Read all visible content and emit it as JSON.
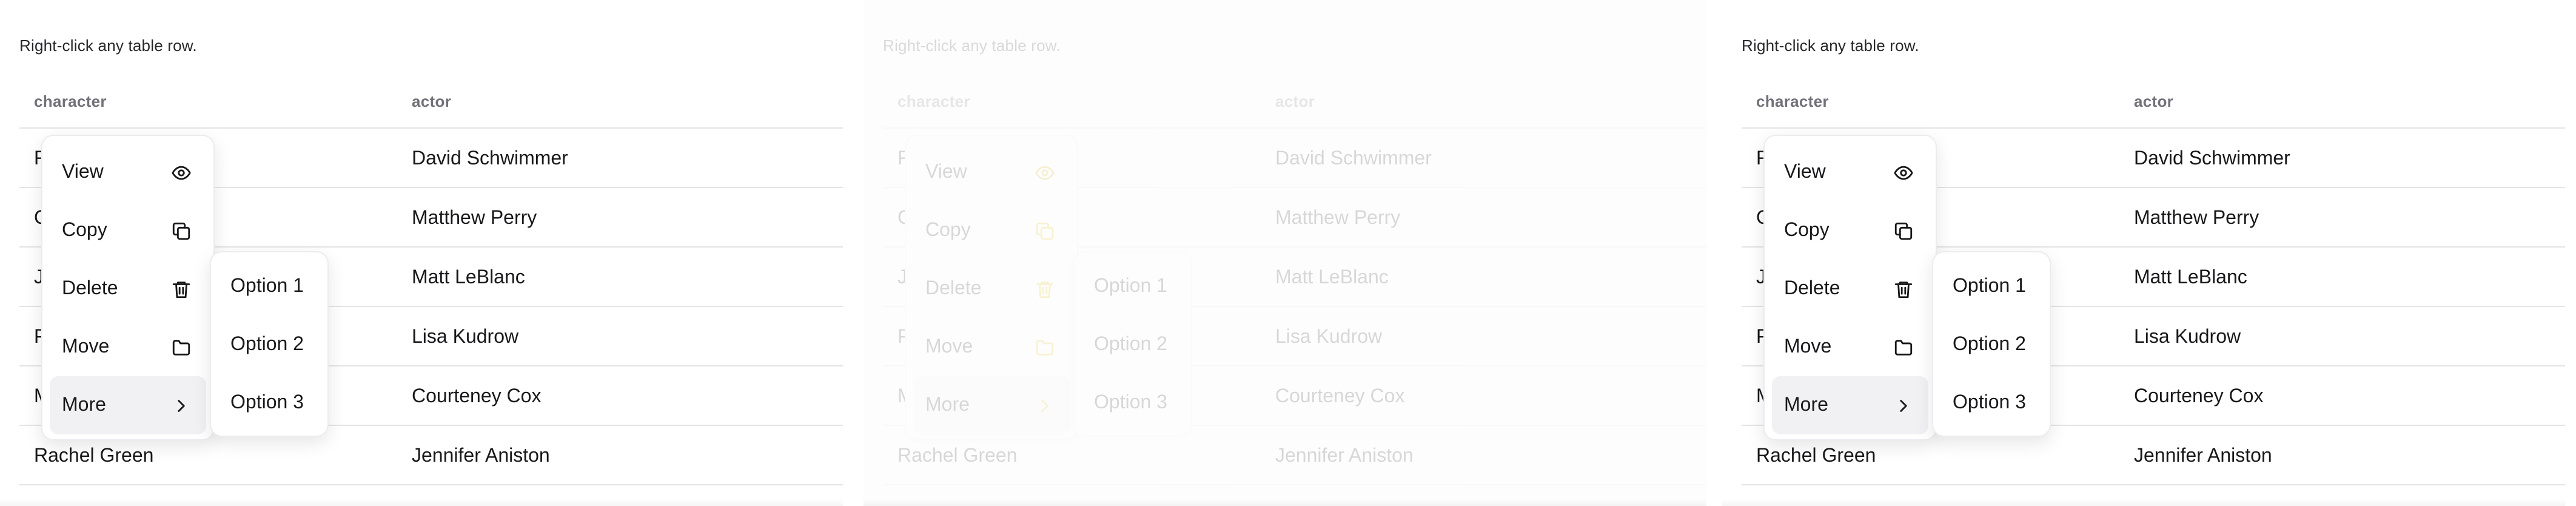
{
  "hint": "Right-click any table row.",
  "table": {
    "headers": [
      "character",
      "actor"
    ],
    "rows": [
      [
        "Ross Geller",
        "David Schwimmer"
      ],
      [
        "Chandler Bing",
        "Matthew Perry"
      ],
      [
        "Joey Tribbiani",
        "Matt LeBlanc"
      ],
      [
        "Phoebe Buffay",
        "Lisa Kudrow"
      ],
      [
        "Monica Geller",
        "Courteney Cox"
      ],
      [
        "Rachel Green",
        "Jennifer Aniston"
      ]
    ]
  },
  "context_menu": {
    "items": [
      {
        "label": "View",
        "icon": "eye-icon"
      },
      {
        "label": "Copy",
        "icon": "copy-icon"
      },
      {
        "label": "Delete",
        "icon": "trash-icon"
      },
      {
        "label": "Move",
        "icon": "folder-icon"
      },
      {
        "label": "More",
        "icon": "chevron-right-icon"
      }
    ],
    "active_item": "More"
  },
  "submenu": {
    "items": [
      "Option 1",
      "Option 2",
      "Option 3"
    ]
  },
  "colors": {
    "text": "#18181b",
    "muted_header": "#71717a",
    "border": "#e4e4e7",
    "active_item_bg": "#f1f1f3",
    "faded_icon_accent": "#d8a800"
  }
}
